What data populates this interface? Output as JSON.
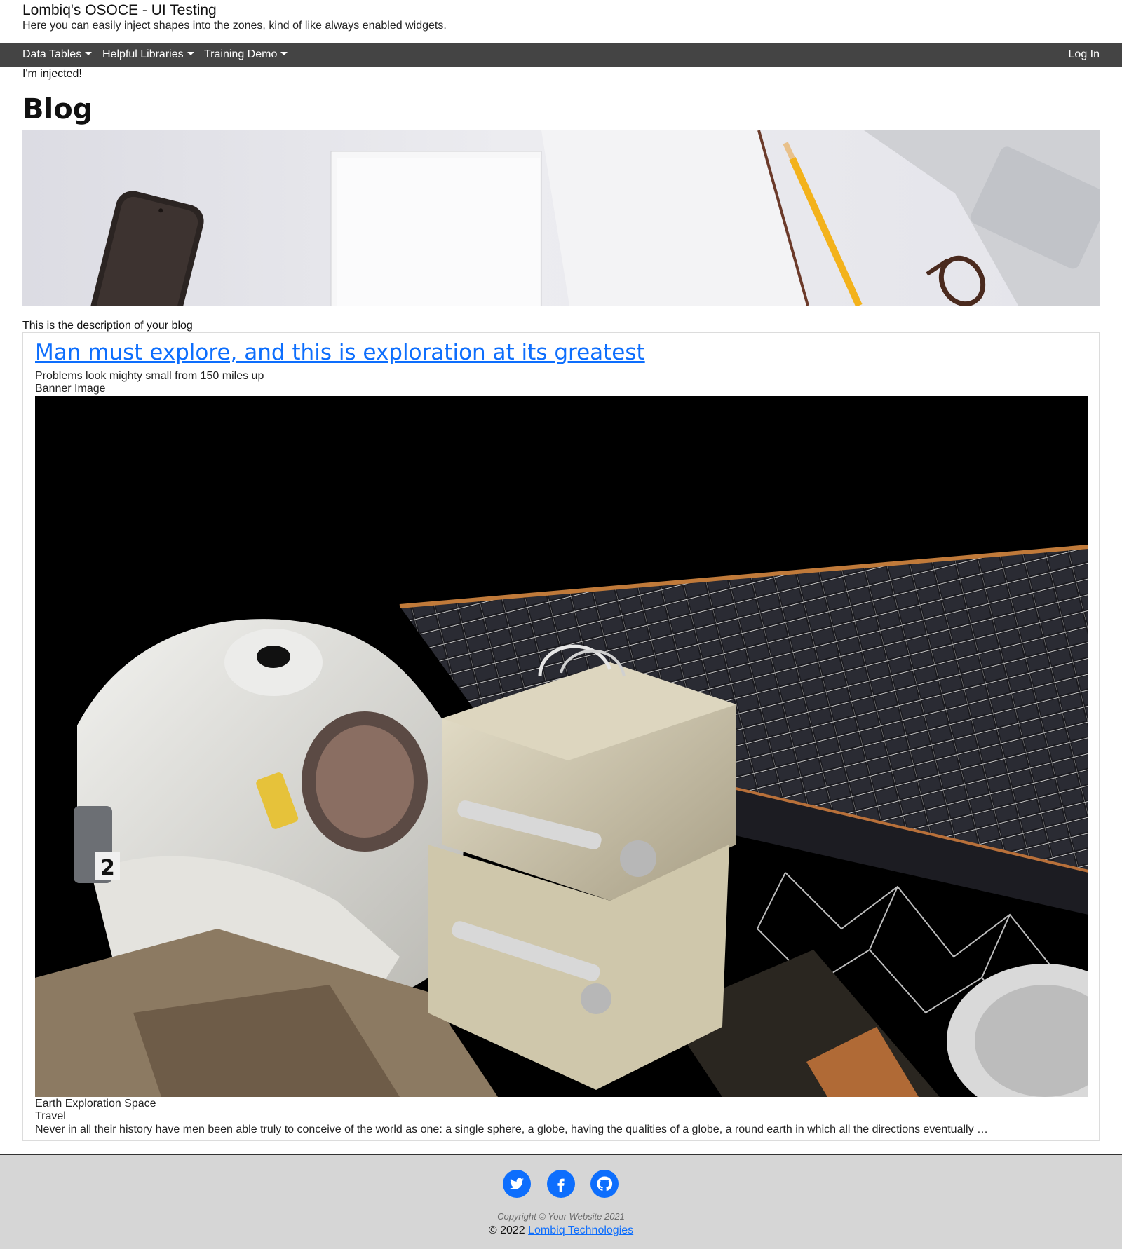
{
  "site": {
    "title": "Lombiq's OSOCE - UI Testing",
    "tagline": "Here you can easily inject shapes into the zones, kind of like always enabled widgets."
  },
  "nav": {
    "items": [
      {
        "label": "Data Tables",
        "dropdown": true
      },
      {
        "label": "Helpful Libraries",
        "dropdown": true
      },
      {
        "label": "Training Demo",
        "dropdown": true
      }
    ],
    "login_label": "Log In"
  },
  "injected_text": "I'm injected!",
  "blog": {
    "heading": "Blog",
    "description": "This is the description of your blog"
  },
  "post": {
    "title": "Man must explore, and this is exploration at its greatest",
    "subtitle": "Problems look mighty small from 150 miles up",
    "banner_label": "Banner Image",
    "tags": "Earth Exploration Space",
    "category": "Travel",
    "excerpt": "Never in all their history have men been able truly to conceive of the world as one: a single sphere, a globe, having the qualities of a globe, a round earth in which all the directions eventually …"
  },
  "footer": {
    "social": [
      {
        "icon": "twitter-icon"
      },
      {
        "icon": "facebook-icon"
      },
      {
        "icon": "github-icon"
      }
    ],
    "copyright": "Copyright © Your Website 2021",
    "company_prefix": "© 2022",
    "company_link": "Lombiq Technologies"
  },
  "colors": {
    "accent": "#0d6efd",
    "navbar": "#444444",
    "footer": "#d6d6d6"
  }
}
